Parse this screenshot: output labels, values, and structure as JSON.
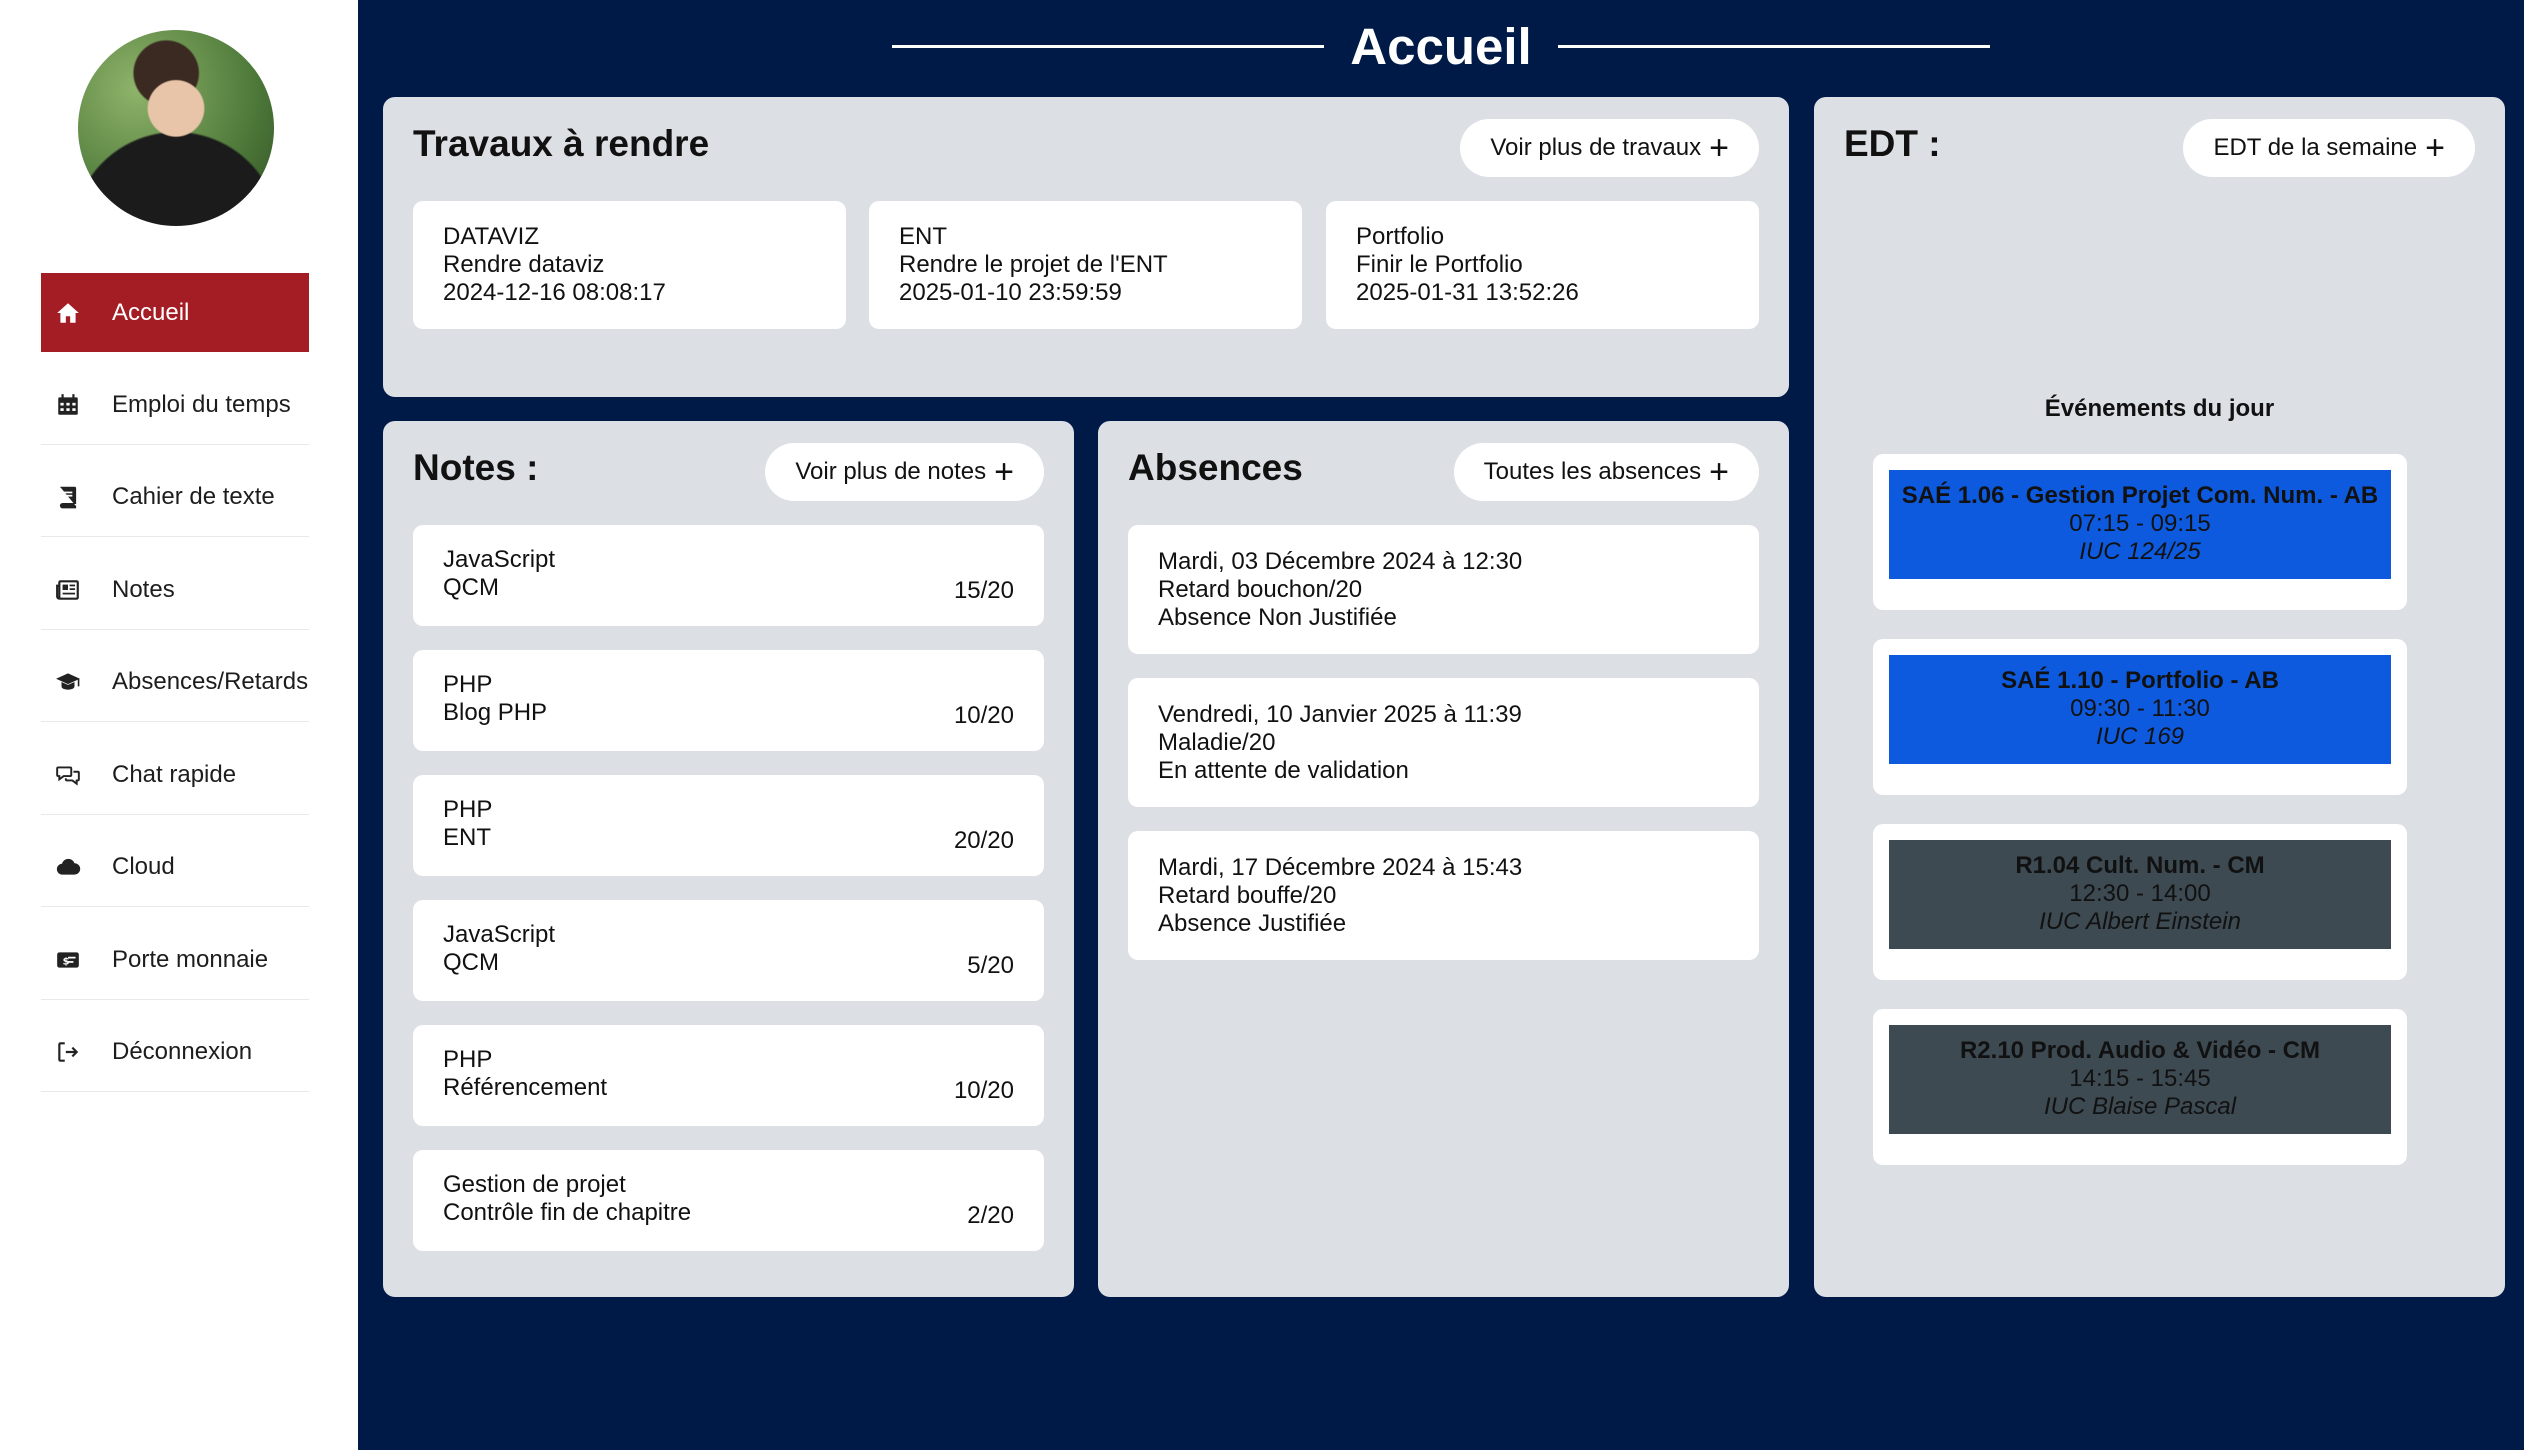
{
  "sidebar": {
    "items": [
      {
        "label": "Accueil",
        "icon": "home-icon"
      },
      {
        "label": "Emploi du temps",
        "icon": "calendar-icon"
      },
      {
        "label": "Cahier de texte",
        "icon": "book-icon"
      },
      {
        "label": "Notes",
        "icon": "newspaper-icon"
      },
      {
        "label": "Absences/Retards",
        "icon": "graduation-cap-icon"
      },
      {
        "label": "Chat rapide",
        "icon": "chat-bubbles-icon"
      },
      {
        "label": "Cloud",
        "icon": "cloud-icon"
      },
      {
        "label": "Porte monnaie",
        "icon": "money-card-icon"
      },
      {
        "label": "Déconnexion",
        "icon": "logout-icon"
      }
    ]
  },
  "header": {
    "title": "Accueil"
  },
  "travaux": {
    "title": "Travaux à rendre",
    "more_label": "Voir plus de travaux",
    "items": [
      {
        "subject": "DATAVIZ",
        "task": "Rendre dataviz",
        "date": "2024-12-16 08:08:17"
      },
      {
        "subject": "ENT",
        "task": "Rendre le projet de l'ENT",
        "date": "2025-01-10 23:59:59"
      },
      {
        "subject": "Portfolio",
        "task": "Finir le Portfolio",
        "date": "2025-01-31 13:52:26"
      }
    ]
  },
  "notes": {
    "title": "Notes :",
    "more_label": "Voir plus de notes",
    "items": [
      {
        "subject": "JavaScript",
        "label": "QCM",
        "grade": "15/20"
      },
      {
        "subject": "PHP",
        "label": "Blog PHP",
        "grade": "10/20"
      },
      {
        "subject": "PHP",
        "label": "ENT",
        "grade": "20/20"
      },
      {
        "subject": "JavaScript",
        "label": "QCM",
        "grade": "5/20"
      },
      {
        "subject": "PHP",
        "label": "Référencement",
        "grade": "10/20"
      },
      {
        "subject": "Gestion de projet",
        "label": "Contrôle fin de chapitre",
        "grade": "2/20"
      }
    ]
  },
  "absences": {
    "title": "Absences",
    "more_label": "Toutes les absences",
    "items": [
      {
        "date": "Mardi, 03 Décembre 2024 à 12:30",
        "reason": "Retard bouchon/20",
        "status": "Absence Non Justifiée"
      },
      {
        "date": "Vendredi, 10 Janvier 2025 à 11:39",
        "reason": "Maladie/20",
        "status": "En attente de validation"
      },
      {
        "date": "Mardi, 17 Décembre 2024 à 15:43",
        "reason": "Retard bouffe/20",
        "status": "Absence Justifiée"
      }
    ]
  },
  "edt": {
    "title": "EDT :",
    "more_label": "EDT de la semaine",
    "events_title": "Événements du jour",
    "events": [
      {
        "title": "SAÉ 1.06 - Gestion Projet Com. Num. - AB",
        "time": "07:15 - 09:15",
        "room": "IUC 124/25",
        "color": "#0e5adf"
      },
      {
        "title": "SAÉ 1.10 - Portfolio - AB",
        "time": "09:30 - 11:30",
        "room": "IUC 169",
        "color": "#0e5adf"
      },
      {
        "title": "R1.04 Cult. Num. - CM",
        "time": "12:30 - 14:00",
        "room": "IUC Albert Einstein",
        "color": "#3d4a52"
      },
      {
        "title": "R2.10 Prod. Audio & Vidéo - CM",
        "time": "14:15 - 15:45",
        "room": "IUC Blaise Pascal",
        "color": "#3d4a52"
      }
    ]
  },
  "colors": {
    "background": "#001a48",
    "active_nav": "#a51d24",
    "panel": "#dcdfe4"
  }
}
